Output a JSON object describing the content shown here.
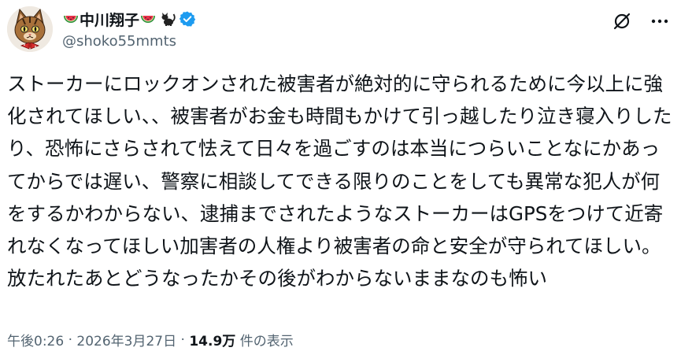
{
  "author": {
    "display_name": "中川翔子",
    "handle": "@shoko55mmts",
    "name_emojis": [
      "watermelon-icon",
      "watermelon-icon",
      "black-cat-icon"
    ],
    "verified": true,
    "avatar": "cartoon-cat-avatar"
  },
  "header_icons": [
    "grok-icon",
    "more-icon"
  ],
  "tweet": {
    "text": "ストーカーにロックオンされた被害者が絶対的に守られるために今以上に強化されてほしい、、被害者がお金も時間もかけて引っ越したり泣き寝入りしたり、恐怖にさらされて怯えて日々を過ごすのは本当につらいことなにかあってからでは遅い、警察に相談してできる限りのことをしても異常な犯人が何をするかわからない、逮捕までされたようなストーカーはGPSをつけて近寄れなくなってほしい加害者の人権より被害者の命と安全が守られてほしい。放たれたあとどうなったかその後がわからないままなのも怖い"
  },
  "meta": {
    "time": "午後0:26",
    "separator": "·",
    "date": "2026年3月27日",
    "views_count": "14.9万",
    "views_label": "件の表示"
  },
  "colors": {
    "text_primary": "#0f1419",
    "text_secondary": "#536471",
    "verified_blue": "#1d9bf0"
  }
}
